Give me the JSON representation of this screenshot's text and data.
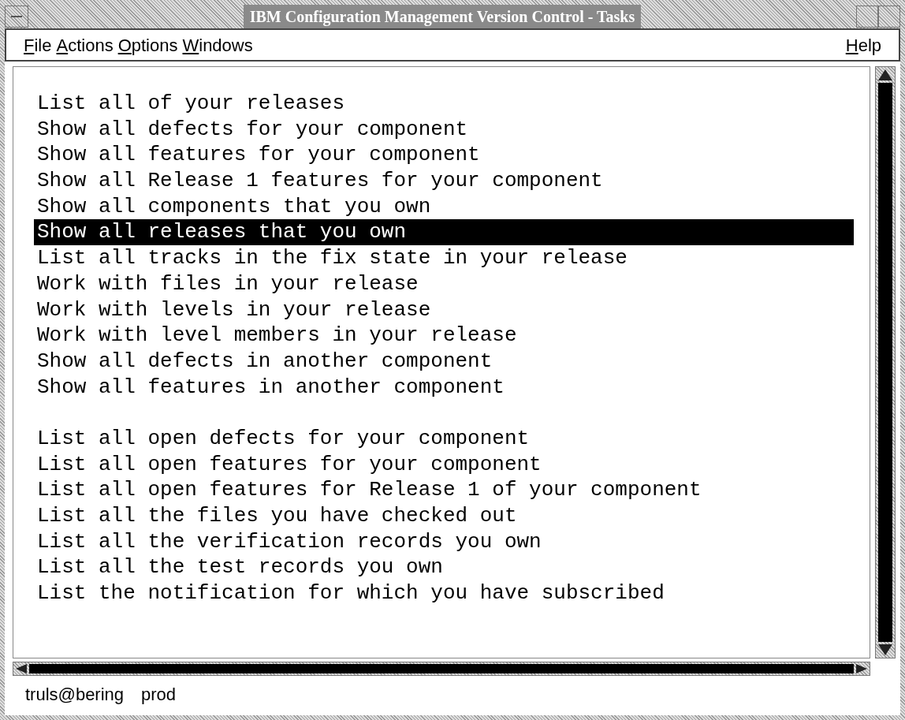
{
  "window": {
    "title": "IBM Configuration Management Version Control - Tasks"
  },
  "menu": [
    {
      "label": "File"
    },
    {
      "label": "Actions"
    },
    {
      "label": "Options"
    },
    {
      "label": "Windows"
    }
  ],
  "help_menu": {
    "label": "Help"
  },
  "task_groups": [
    [
      {
        "label": "List all of your releases",
        "selected": false
      },
      {
        "label": "Show all defects for your component",
        "selected": false
      },
      {
        "label": "Show all features for your component",
        "selected": false
      },
      {
        "label": "Show all Release 1 features for your component",
        "selected": false
      },
      {
        "label": "Show all components that you own",
        "selected": false
      },
      {
        "label": "Show all releases that you own",
        "selected": true
      },
      {
        "label": "List all tracks in the fix state in your release",
        "selected": false
      },
      {
        "label": "Work with files in your release",
        "selected": false
      },
      {
        "label": "Work with levels in your release",
        "selected": false
      },
      {
        "label": "Work with level members in your release",
        "selected": false
      },
      {
        "label": "Show all defects in another component",
        "selected": false
      },
      {
        "label": "Show all features in another component",
        "selected": false
      }
    ],
    [
      {
        "label": "List all open defects for your component",
        "selected": false
      },
      {
        "label": "List all open features for your component",
        "selected": false
      },
      {
        "label": "List all open features for Release 1 of your component",
        "selected": false
      },
      {
        "label": "List all the files you have checked out",
        "selected": false
      },
      {
        "label": "List all the verification records you own",
        "selected": false
      },
      {
        "label": "List all the test records you own",
        "selected": false
      },
      {
        "label": "List the notification for which you have subscribed",
        "selected": false
      }
    ]
  ],
  "status_bar": {
    "user": "truls@bering",
    "family": "prod"
  }
}
